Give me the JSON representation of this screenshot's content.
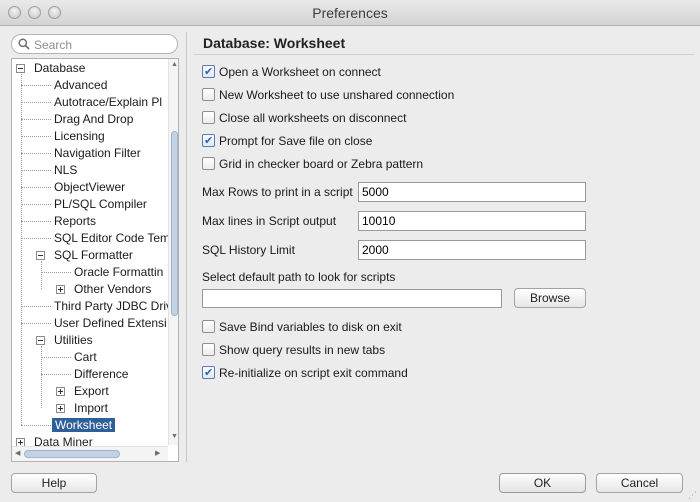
{
  "window": {
    "title": "Preferences"
  },
  "search": {
    "placeholder": "Search",
    "icon": "search-icon"
  },
  "tree": {
    "items": [
      {
        "label": "Database",
        "level": 0,
        "toggle": "minus"
      },
      {
        "label": "Advanced",
        "level": 1
      },
      {
        "label": "Autotrace/Explain Pl",
        "level": 1
      },
      {
        "label": "Drag And Drop",
        "level": 1
      },
      {
        "label": "Licensing",
        "level": 1
      },
      {
        "label": "Navigation Filter",
        "level": 1
      },
      {
        "label": "NLS",
        "level": 1
      },
      {
        "label": "ObjectViewer",
        "level": 1
      },
      {
        "label": "PL/SQL Compiler",
        "level": 1
      },
      {
        "label": "Reports",
        "level": 1
      },
      {
        "label": "SQL Editor Code Tem",
        "level": 1
      },
      {
        "label": "SQL Formatter",
        "level": 1,
        "toggle": "minus"
      },
      {
        "label": "Oracle Formattin",
        "level": 2
      },
      {
        "label": "Other Vendors",
        "level": 2,
        "toggle": "plus"
      },
      {
        "label": "Third Party JDBC Driv",
        "level": 1
      },
      {
        "label": "User Defined Extensi",
        "level": 1
      },
      {
        "label": "Utilities",
        "level": 1,
        "toggle": "minus"
      },
      {
        "label": "Cart",
        "level": 2
      },
      {
        "label": "Difference",
        "level": 2
      },
      {
        "label": "Export",
        "level": 2,
        "toggle": "plus"
      },
      {
        "label": "Import",
        "level": 2,
        "toggle": "plus"
      },
      {
        "label": "Worksheet",
        "level": 1,
        "selected": true
      },
      {
        "label": "Data Miner",
        "level": 0,
        "toggle": "plus"
      }
    ]
  },
  "panel": {
    "title": "Database: Worksheet",
    "checkboxes_top": [
      {
        "label": "Open a Worksheet on connect",
        "checked": true
      },
      {
        "label": "New Worksheet to use unshared connection",
        "checked": false
      },
      {
        "label": "Close all worksheets on disconnect",
        "checked": false
      },
      {
        "label": "Prompt for Save file on close",
        "checked": true
      },
      {
        "label": "Grid in checker board or Zebra pattern",
        "checked": false
      }
    ],
    "fields": [
      {
        "label": "Max Rows to print in a script",
        "value": "5000"
      },
      {
        "label": "Max lines in Script output",
        "value": "10010"
      },
      {
        "label": "SQL History Limit",
        "value": "2000"
      }
    ],
    "path": {
      "label": "Select default path to look for scripts",
      "value": "",
      "browse_label": "Browse"
    },
    "checkboxes_bottom": [
      {
        "label": "Save Bind variables to disk on exit",
        "checked": false
      },
      {
        "label": "Show query results in new tabs",
        "checked": false
      },
      {
        "label": "Re-initialize on script exit command",
        "checked": true
      }
    ]
  },
  "buttons": {
    "help": "Help",
    "ok": "OK",
    "cancel": "Cancel"
  },
  "colors": {
    "selection": "#2e5f9a",
    "check_accent": "#2d63b4"
  }
}
